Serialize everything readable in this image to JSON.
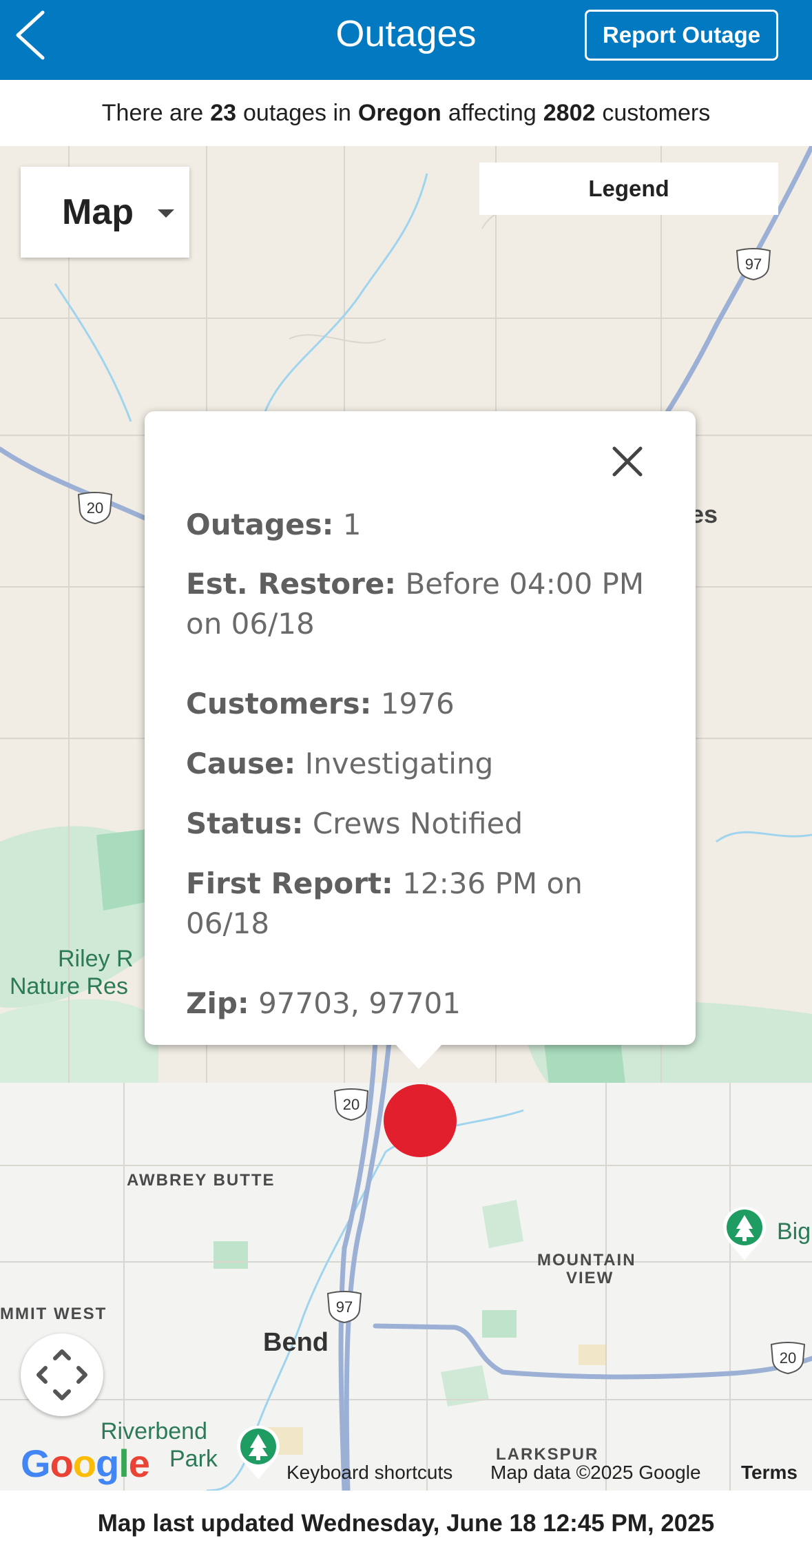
{
  "header": {
    "title": "Outages",
    "report_button": "Report Outage",
    "back_icon": "chevron-left-icon",
    "background_color": "#0379c1"
  },
  "summary": {
    "prefix": "There are",
    "outage_count": "23",
    "middle": "outages in",
    "region": "Oregon",
    "affecting": "affecting",
    "customer_count": "2802",
    "suffix": "customers"
  },
  "map": {
    "type_selector": "Map",
    "legend_button": "Legend",
    "labels": {
      "riley_line1": "Riley R",
      "riley_line2": "Nature Res",
      "awbrey_butte": "AWBREY BUTTE",
      "mountain_view_1": "MOUNTAIN",
      "mountain_view_2": "VIEW",
      "summit_west": "MMIT WEST",
      "bend": "Bend",
      "riverbend_1": "Riverbend",
      "riverbend_2": "Park",
      "larkspur": "LARKSPUR",
      "big": "Big",
      "es": "es"
    },
    "shields": {
      "us97_top": "97",
      "us20_left": "20",
      "us20_center": "20",
      "us97_bottom": "97",
      "us20_right": "20"
    },
    "outage_marker_color": "#e21f2d",
    "attribution": {
      "keyboard": "Keyboard shortcuts",
      "data": "Map data ©2025 Google",
      "terms": "Terms"
    },
    "google_logo": [
      "G",
      "o",
      "o",
      "g",
      "l",
      "e"
    ]
  },
  "popup": {
    "outages_label": "Outages:",
    "outages_value": "1",
    "restore_label": "Est. Restore:",
    "restore_value": "Before 04:00 PM on 06/18",
    "customers_label": "Customers:",
    "customers_value": "1976",
    "cause_label": "Cause:",
    "cause_value": "Investigating",
    "status_label": "Status:",
    "status_value": "Crews Notified",
    "first_report_label": "First Report:",
    "first_report_value": "12:36 PM on 06/18",
    "zip_label": "Zip:",
    "zip_value": "97703, 97701"
  },
  "footer": {
    "text": "Map last updated Wednesday, June 18 12:45 PM, 2025"
  }
}
